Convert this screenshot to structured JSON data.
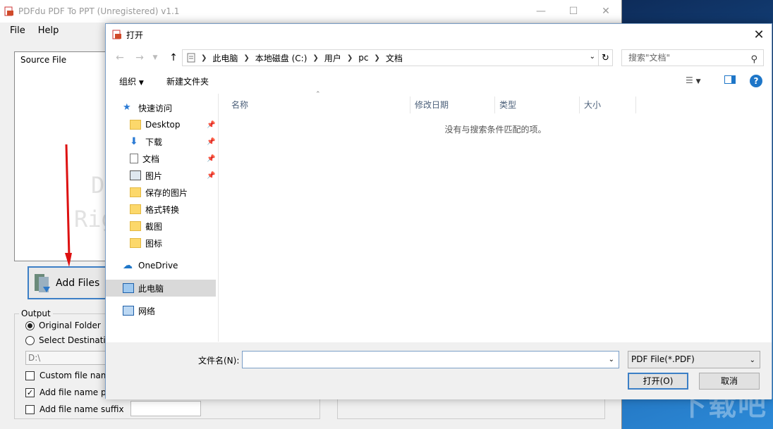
{
  "app": {
    "title": "PDFdu PDF To PPT (Unregistered) v1.1",
    "menu": [
      "File",
      "Help"
    ],
    "source_label": "Source File",
    "watermark_line1": "D",
    "watermark_line2": "Rig",
    "add_files_label": "Add Files",
    "output_label": "Output",
    "original_folder": "Original Folder",
    "select_destination": "Select Destination",
    "path_value": "D:\\",
    "custom_file_name": "Custom file name",
    "add_prefix": "Add file name prefix",
    "add_suffix": "Add file name suffix"
  },
  "dialog": {
    "title": "打开",
    "breadcrumb": [
      "此电脑",
      "本地磁盘 (C:)",
      "用户",
      "pc",
      "文档"
    ],
    "search_placeholder": "搜索\"文档\"",
    "toolbar": {
      "organize": "组织",
      "new_folder": "新建文件夹"
    },
    "nav": {
      "quick_access": "快速访问",
      "items": [
        "Desktop",
        "下载",
        "文档",
        "图片",
        "保存的图片",
        "格式转换",
        "截图",
        "图标"
      ],
      "onedrive": "OneDrive",
      "this_pc": "此电脑",
      "network": "网络"
    },
    "columns": [
      "名称",
      "修改日期",
      "类型",
      "大小"
    ],
    "empty_message": "没有与搜索条件匹配的项。",
    "filename_label": "文件名(N):",
    "filename_value": "",
    "filter_value": "PDF File(*.PDF)",
    "open_button": "打开(O)",
    "cancel_button": "取消"
  },
  "desktop": {
    "watermark": "下载吧"
  }
}
